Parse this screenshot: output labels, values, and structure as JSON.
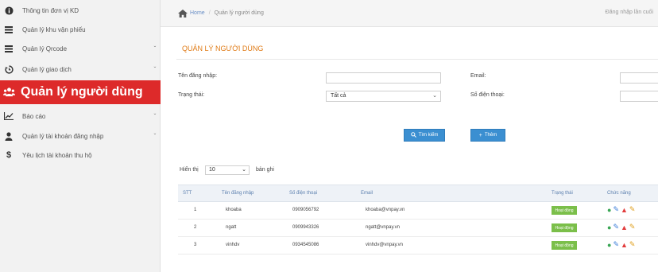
{
  "sidebar": {
    "items": [
      {
        "icon": "info-icon",
        "glyph": "ℹ",
        "label": "Thông tin đơn vị KD",
        "chevron": ""
      },
      {
        "icon": "list-icon",
        "glyph": "☰",
        "label": "Quản lý khu vận phiếu",
        "chevron": ""
      },
      {
        "icon": "list-icon",
        "glyph": "☰",
        "label": "Quản lý Qrcode",
        "chevron": "ˇ"
      },
      {
        "icon": "history-icon",
        "glyph": "↻",
        "label": "Quản lý giao dịch",
        "chevron": "ˇ"
      },
      {
        "icon": "users-icon",
        "glyph": "☖",
        "label": "Quản lý người dùng",
        "chevron": ""
      },
      {
        "icon": "chart-icon",
        "glyph": "↗",
        "label": "Báo cáo",
        "chevron": "ˇ"
      },
      {
        "icon": "user-icon",
        "glyph": "☻",
        "label": "Quản lý tài khoản đăng nhập",
        "chevron": "ˇ"
      },
      {
        "icon": "dollar-icon",
        "glyph": "$",
        "label": "Yêu lịch tài khoản thu hộ",
        "chevron": ""
      }
    ],
    "active_color": "#dd2a2a"
  },
  "topbar": {
    "home_label": "Home",
    "crumb": "Quản lý người dùng",
    "right_text": "Đăng nhập lần cuối"
  },
  "main": {
    "page_title": "QUẢN LÝ NGƯỜI DÙNG",
    "filters": {
      "username_label": "Tên đăng nhập:",
      "username_value": "",
      "email_label": "Email:",
      "email_value": "",
      "status_label": "Trạng thái:",
      "status_value": "Tất cả",
      "phone_label": "Số điện thoại:",
      "phone_value": ""
    },
    "buttons": {
      "search": "Tìm kiếm",
      "add": "Thêm"
    },
    "show": {
      "prefix": "Hiển thị",
      "value": "10",
      "suffix": "bản ghi"
    }
  },
  "table": {
    "headers": [
      "STT",
      "Tên đăng nhập",
      "Số điện thoại",
      "Email",
      "Trạng thái",
      "Chức năng"
    ],
    "rows": [
      {
        "stt": "1",
        "username": "khoaba",
        "phone": "0909056792",
        "email": "khoaba@vnpay.vn",
        "status": "Hoạt động"
      },
      {
        "stt": "2",
        "username": "ngatt",
        "phone": "0909943326",
        "email": "ngatt@vnpay.vn",
        "status": "Hoạt động"
      },
      {
        "stt": "3",
        "username": "vinhdv",
        "phone": "0934545086",
        "email": "vinhdv@vnpay.vn",
        "status": "Hoạt động"
      }
    ],
    "status_color": "#7bbf4a"
  }
}
